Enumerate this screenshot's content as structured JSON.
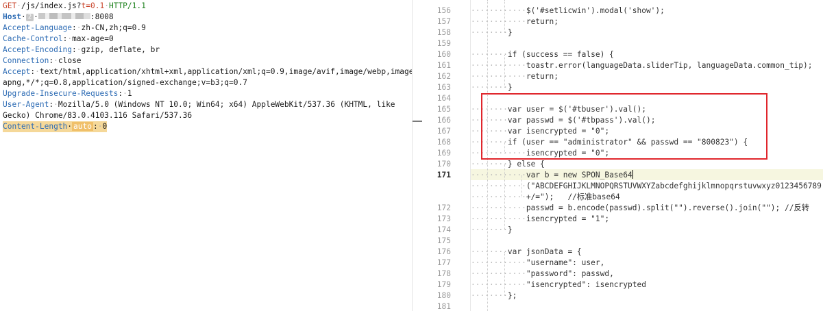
{
  "request": {
    "method": "GET",
    "path": "/js/index.js?",
    "query": "t=0.1",
    "version": "HTTP/1.1",
    "host_badge": "2",
    "host_port": ":8008",
    "accept_language": "zh-CN,zh;q=0.9",
    "cache_control": "max-age=0",
    "accept_encoding": "gzip, deflate, br",
    "connection": "close",
    "accept_1": "text/html,application/xhtml+xml,application/xml;q=0.9,image/avif,image/webp,image/",
    "accept_2": "apng,*/*;q=0.8,application/signed-exchange;v=b3;q=0.7",
    "upgrade": "1",
    "ua_1": "Mozilla/5.0 (Windows NT 10.0; Win64; x64) AppleWebKit/537.36 (KHTML, like",
    "ua_2": "Gecko) Chrome/83.0.4103.116 Safari/537.36",
    "content_length_badge": "auto",
    "content_length": "0"
  },
  "headers": {
    "host": "Host",
    "accept_language": "Accept-Language",
    "cache_control": "Cache-Control",
    "accept_encoding": "Accept-Encoding",
    "connection": "Connection",
    "accept": "Accept",
    "upgrade": "Upgrade-Insecure-Requests",
    "user_agent": "User-Agent",
    "content_length": "Content-Length"
  },
  "editor": {
    "current_line": "171",
    "lines": [
      {
        "n": "156",
        "text": "$('#setlicwin').modal('show');"
      },
      {
        "n": "157",
        "text": "return;"
      },
      {
        "n": "158",
        "text": "}"
      },
      {
        "n": "159",
        "text": ""
      },
      {
        "n": "160",
        "text": "if (success == false) {"
      },
      {
        "n": "161",
        "text": "toastr.error(languageData.sliderTip, languageData.common_tip);"
      },
      {
        "n": "162",
        "text": "return;"
      },
      {
        "n": "163",
        "text": "}"
      },
      {
        "n": "164",
        "text": ""
      },
      {
        "n": "165",
        "text": "var user = $('#tbuser').val();"
      },
      {
        "n": "166",
        "text": "var passwd = $('#tbpass').val();"
      },
      {
        "n": "167",
        "text": "var isencrypted = \"0\";"
      },
      {
        "n": "168",
        "text": "if (user == \"administrator\" && passwd == \"800823\") {"
      },
      {
        "n": "169",
        "text": "isencrypted = \"0\";"
      },
      {
        "n": "170",
        "text": "} else {"
      },
      {
        "n": "171",
        "text": "var b = new SPON_Base64"
      },
      {
        "n": "",
        "text": "(\"ABCDEFGHIJKLMNOPQRSTUVWXYZabcdefghijklmnopqrstuvwxyz0123456789"
      },
      {
        "n": "",
        "text": "+/=\");   //标准base64"
      },
      {
        "n": "172",
        "text": "passwd = b.encode(passwd).split(\"\").reverse().join(\"\"); //反转"
      },
      {
        "n": "173",
        "text": "isencrypted = \"1\";"
      },
      {
        "n": "174",
        "text": "}"
      },
      {
        "n": "175",
        "text": ""
      },
      {
        "n": "176",
        "text": "var jsonData = {"
      },
      {
        "n": "177",
        "text": "\"username\": user,"
      },
      {
        "n": "178",
        "text": "\"password\": passwd,"
      },
      {
        "n": "179",
        "text": "\"isencrypted\": isencrypted"
      },
      {
        "n": "180",
        "text": "};"
      },
      {
        "n": "181",
        "text": ""
      }
    ]
  },
  "colors": {
    "method": "#c9462c",
    "header_name": "#2f6db5",
    "http_version": "#1a7f1a",
    "content_length_highlight": "#f5d899",
    "highlight_box": "#e0262c"
  }
}
